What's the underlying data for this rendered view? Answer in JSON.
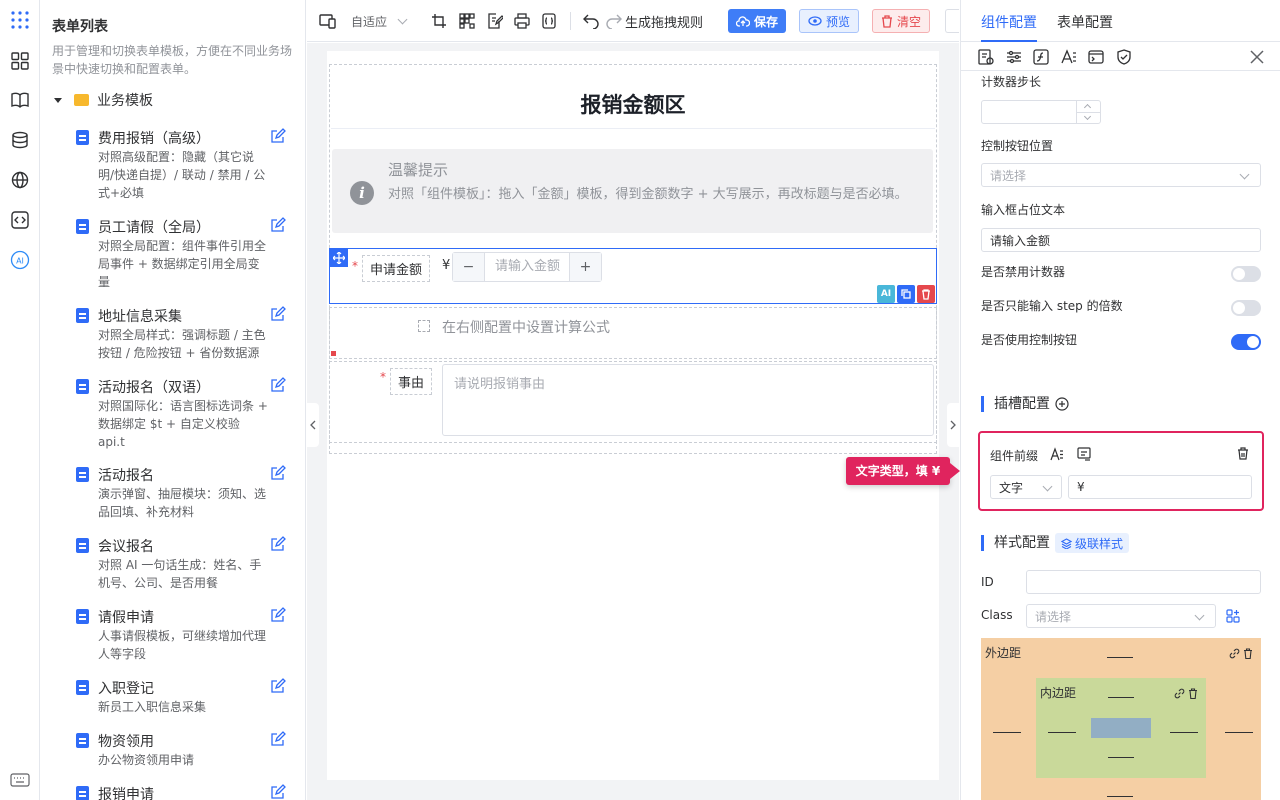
{
  "sidebar": {
    "title": "表单列表",
    "description": "用于管理和切换表单模板，方便在不同业务场景中快速切换和配置表单。",
    "folder": "业务模板",
    "items": [
      {
        "title": "费用报销（高级）",
        "desc": "对照高级配置：隐藏（其它说明/快递自提）/ 联动 / 禁用 / 公式+必填"
      },
      {
        "title": "员工请假（全局）",
        "desc": "对照全局配置：组件事件引用全局事件 + 数据绑定引用全局变量"
      },
      {
        "title": "地址信息采集",
        "desc": "对照全局样式：强调标题 / 主色按钮 / 危险按钮 + 省份数据源"
      },
      {
        "title": "活动报名（双语）",
        "desc": "对照国际化：语言图标选词条 + 数据绑定 $t + 自定义校验 api.t"
      },
      {
        "title": "活动报名",
        "desc": "演示弹窗、抽屉模块：须知、选品回填、补充材料"
      },
      {
        "title": "会议报名",
        "desc": "对照 AI 一句话生成：姓名、手机号、公司、是否用餐"
      },
      {
        "title": "请假申请",
        "desc": "人事请假模板，可继续增加代理人等字段"
      },
      {
        "title": "入职登记",
        "desc": "新员工入职信息采集"
      },
      {
        "title": "物资领用",
        "desc": "办公物资领用申请"
      },
      {
        "title": "报销申请",
        "desc": ""
      }
    ]
  },
  "toolbar": {
    "adapt": "自适应",
    "rules": "生成拖拽规则",
    "save": "保存",
    "preview": "预览",
    "clear": "清空"
  },
  "canvas": {
    "section_title": "报销金额区",
    "tip_title": "温馨提示",
    "tip_text": "对照「组件模板」：拖入「金额」模板，得到金额数字 + 大写展示，再改标题与是否必填。",
    "amount_label": "申请金额",
    "amount_prefix": "¥",
    "amount_placeholder": "请输入金额",
    "minus": "−",
    "plus": "+",
    "formula_hint": "在右侧配置中设置计算公式",
    "reason_label": "事由",
    "reason_placeholder": "请说明报销事由",
    "required_mark": "*",
    "ai_badge": "AI"
  },
  "callout": "文字类型，填 ¥",
  "panel": {
    "tabs": [
      "组件配置",
      "表单配置"
    ],
    "step_label": "计数器步长",
    "ctrl_pos_label": "控制按钮位置",
    "ctrl_pos_placeholder": "请选择",
    "placeholder_label": "输入框占位文本",
    "placeholder_value": "请输入金额",
    "disable_counter": "是否禁用计数器",
    "step_multiple": "是否只能输入 step 的倍数",
    "use_ctrl": "是否使用控制按钮",
    "slot_title": "插槽配置",
    "prefix_label": "组件前缀",
    "prefix_type": "文字",
    "prefix_value": "¥",
    "style_title": "样式配置",
    "cascade": "级联样式",
    "id_label": "ID",
    "class_label": "Class",
    "class_placeholder": "请选择",
    "margin_label": "外边距",
    "padding_label": "内边距"
  },
  "colors": {
    "primary": "#2f6bf7",
    "danger": "#e5484d",
    "highlight": "#e0245e",
    "margin_bg": "#f5cfa4",
    "padding_bg": "#c9d99a",
    "content_bg": "#92aec4"
  }
}
